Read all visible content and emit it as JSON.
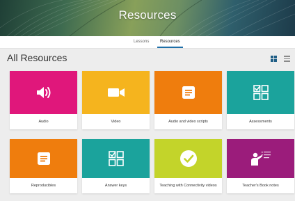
{
  "banner": {
    "title": "Resources"
  },
  "tabs": [
    {
      "label": "Lessons",
      "active": false
    },
    {
      "label": "Resources",
      "active": true
    }
  ],
  "heading": "All Resources",
  "view_toggle": {
    "active": "grid",
    "grid_icon": "grid-view-icon",
    "list_icon": "list-view-icon"
  },
  "colors": {
    "accent": "#1e6fa8",
    "magenta": "#e0177b",
    "yellow": "#f5b41e",
    "orange": "#ef7d0d",
    "teal": "#1ba39c",
    "lime": "#c3d42a",
    "purple": "#9b1c7b"
  },
  "cards": [
    {
      "label": "Audio",
      "icon": "speaker-icon",
      "color": "#e0177b"
    },
    {
      "label": "Video",
      "icon": "video-camera-icon",
      "color": "#f5b41e"
    },
    {
      "label": "Audio and video scripts",
      "icon": "document-icon",
      "color": "#ef7d0d"
    },
    {
      "label": "Assessments",
      "icon": "checklist-icon",
      "color": "#1ba39c"
    },
    {
      "label": "Reproducibles",
      "icon": "document-icon",
      "color": "#ef7d0d"
    },
    {
      "label": "Answer keys",
      "icon": "checklist-icon",
      "color": "#1ba39c"
    },
    {
      "label": "Teaching with Connectivity videos",
      "icon": "checkmark-circle-icon",
      "color": "#c3d42a"
    },
    {
      "label": "Teacher's Book notes",
      "icon": "teacher-presenting-icon",
      "color": "#9b1c7b"
    }
  ]
}
